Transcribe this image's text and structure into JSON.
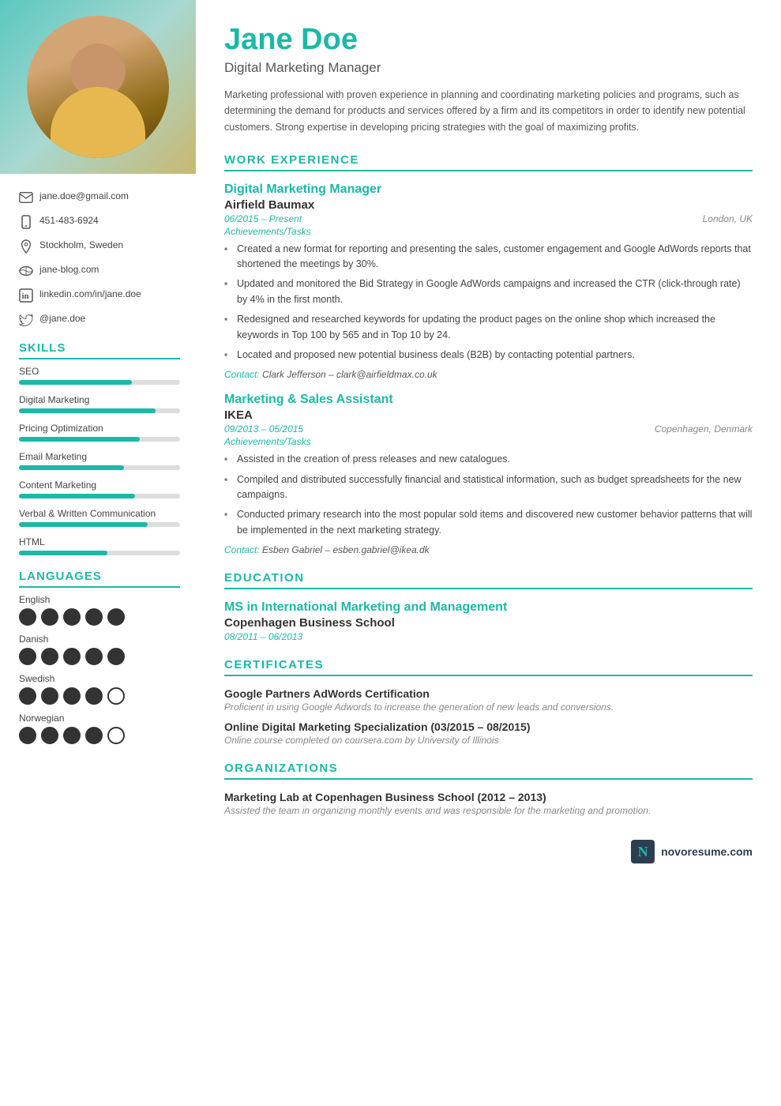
{
  "sidebar": {
    "contact": {
      "email": "jane.doe@gmail.com",
      "phone": "451-483-6924",
      "location": "Stockholm, Sweden",
      "website": "jane-blog.com",
      "linkedin": "linkedin.com/in/jane.doe",
      "twitter": "@jane.doe"
    },
    "skills_section_title": "SKILLS",
    "skills": [
      {
        "name": "SEO",
        "percent": 70
      },
      {
        "name": "Digital Marketing",
        "percent": 85
      },
      {
        "name": "Pricing Optimization",
        "percent": 75
      },
      {
        "name": "Email Marketing",
        "percent": 65
      },
      {
        "name": "Content Marketing",
        "percent": 72
      },
      {
        "name": "Verbal & Written Communication",
        "percent": 80
      },
      {
        "name": "HTML",
        "percent": 55
      }
    ],
    "languages_section_title": "LANGUAGES",
    "languages": [
      {
        "name": "English",
        "filled": 5,
        "total": 5
      },
      {
        "name": "Danish",
        "filled": 5,
        "total": 5
      },
      {
        "name": "Swedish",
        "filled": 4,
        "total": 5
      },
      {
        "name": "Norwegian",
        "filled": 4,
        "total": 5
      }
    ]
  },
  "main": {
    "name": "Jane Doe",
    "title": "Digital Marketing Manager",
    "summary": "Marketing professional with proven experience in planning and coordinating marketing policies and programs, such as determining the demand for products and services offered by a firm and its competitors in order to identify new potential customers. Strong expertise in developing pricing strategies with the goal of maximizing profits.",
    "work_experience_title": "WORK EXPERIENCE",
    "jobs": [
      {
        "title": "Digital Marketing Manager",
        "company": "Airfield Baumax",
        "dates": "06/2015 – Present",
        "location": "London, UK",
        "achievements_label": "Achievements/Tasks",
        "bullets": [
          "Created a new format for reporting and presenting the sales, customer engagement and Google AdWords reports that shortened the meetings by 30%.",
          "Updated and monitored the Bid Strategy in Google AdWords campaigns and increased the CTR (click-through rate) by 4% in the first month.",
          "Redesigned and researched keywords for updating the product pages on the online shop which increased the keywords in Top 100 by 565 and in Top 10 by 24.",
          "Located and proposed new potential business deals (B2B) by contacting potential partners."
        ],
        "contact": "Clark Jefferson – clark@airfieldmax.co.uk"
      },
      {
        "title": "Marketing & Sales Assistant",
        "company": "IKEA",
        "dates": "09/2013 – 05/2015",
        "location": "Copenhagen, Denmark",
        "achievements_label": "Achievements/Tasks",
        "bullets": [
          "Assisted in the creation of press releases and new catalogues.",
          "Compiled and distributed successfully financial and statistical information, such as budget spreadsheets for the new campaigns.",
          "Conducted primary research into the most popular sold items and discovered new customer behavior patterns that will be implemented in the next marketing strategy."
        ],
        "contact": "Esben Gabriel – esben.gabriel@ikea.dk"
      }
    ],
    "education_title": "EDUCATION",
    "education": [
      {
        "degree": "MS in International Marketing and Management",
        "school": "Copenhagen Business School",
        "dates": "08/2011 – 06/2013"
      }
    ],
    "certificates_title": "CERTIFICATES",
    "certificates": [
      {
        "title": "Google Partners AdWords Certification",
        "desc": "Proficient in using Google Adwords to increase the generation of new leads and conversions."
      },
      {
        "title": "Online Digital Marketing Specialization (03/2015 – 08/2015)",
        "desc": "Online course completed on coursera.com by University of Illinois"
      }
    ],
    "organizations_title": "ORGANIZATIONS",
    "organizations": [
      {
        "title": "Marketing Lab at Copenhagen Business School (2012 – 2013)",
        "desc": "Assisted the team in organizing monthly events and was responsible for the marketing and promotion."
      }
    ],
    "brand": "novoresume.com"
  }
}
